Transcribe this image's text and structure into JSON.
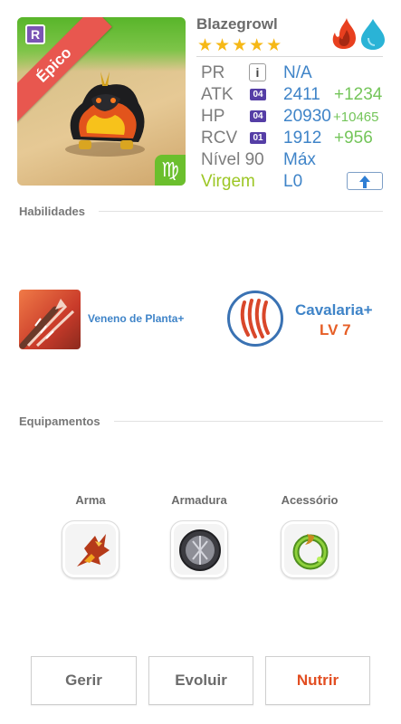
{
  "monster": {
    "name": "Blazegrowl",
    "rarity": "Épico",
    "rarity_letter": "R",
    "stars": "★★★★★",
    "sign_symbol": "♍",
    "elements": [
      "fire-icon",
      "water-drop-icon"
    ]
  },
  "stats": {
    "pr": {
      "label": "PR",
      "value": "N/A",
      "info": "i"
    },
    "atk": {
      "label": "ATK",
      "level": "04",
      "value": "2411",
      "bonus": "+1234"
    },
    "hp": {
      "label": "HP",
      "level": "04",
      "value": "20930",
      "bonus": "+10465"
    },
    "rcv": {
      "label": "RCV",
      "level": "01",
      "value": "1912",
      "bonus": "+956"
    },
    "nivel": {
      "label": "Nível 90",
      "value": "Máx"
    },
    "virgem": {
      "label": "Virgem",
      "value": "L0"
    }
  },
  "abilities": {
    "title": "Habilidades",
    "active": {
      "name": "Veneno de Planta+",
      "icon": "poison-plant-skill-icon"
    },
    "passive": {
      "name": "Cavalaria+",
      "level": "LV 7",
      "icon": "claw-mark-icon"
    }
  },
  "equipment": {
    "title": "Equipamentos",
    "slots": [
      {
        "label": "Arma",
        "icon": "weapon-icon"
      },
      {
        "label": "Armadura",
        "icon": "armor-icon"
      },
      {
        "label": "Acessório",
        "icon": "accessory-icon"
      }
    ]
  },
  "actions": {
    "gerir": "Gerir",
    "evoluir": "Evoluir",
    "nutrir": "Nutrir"
  },
  "colors": {
    "accent_blue": "#3f84c8",
    "bonus_green": "#74c55a",
    "rarity_red": "#e8574f",
    "nutrir_orange": "#e24e22",
    "star_gold": "#f6b816"
  }
}
